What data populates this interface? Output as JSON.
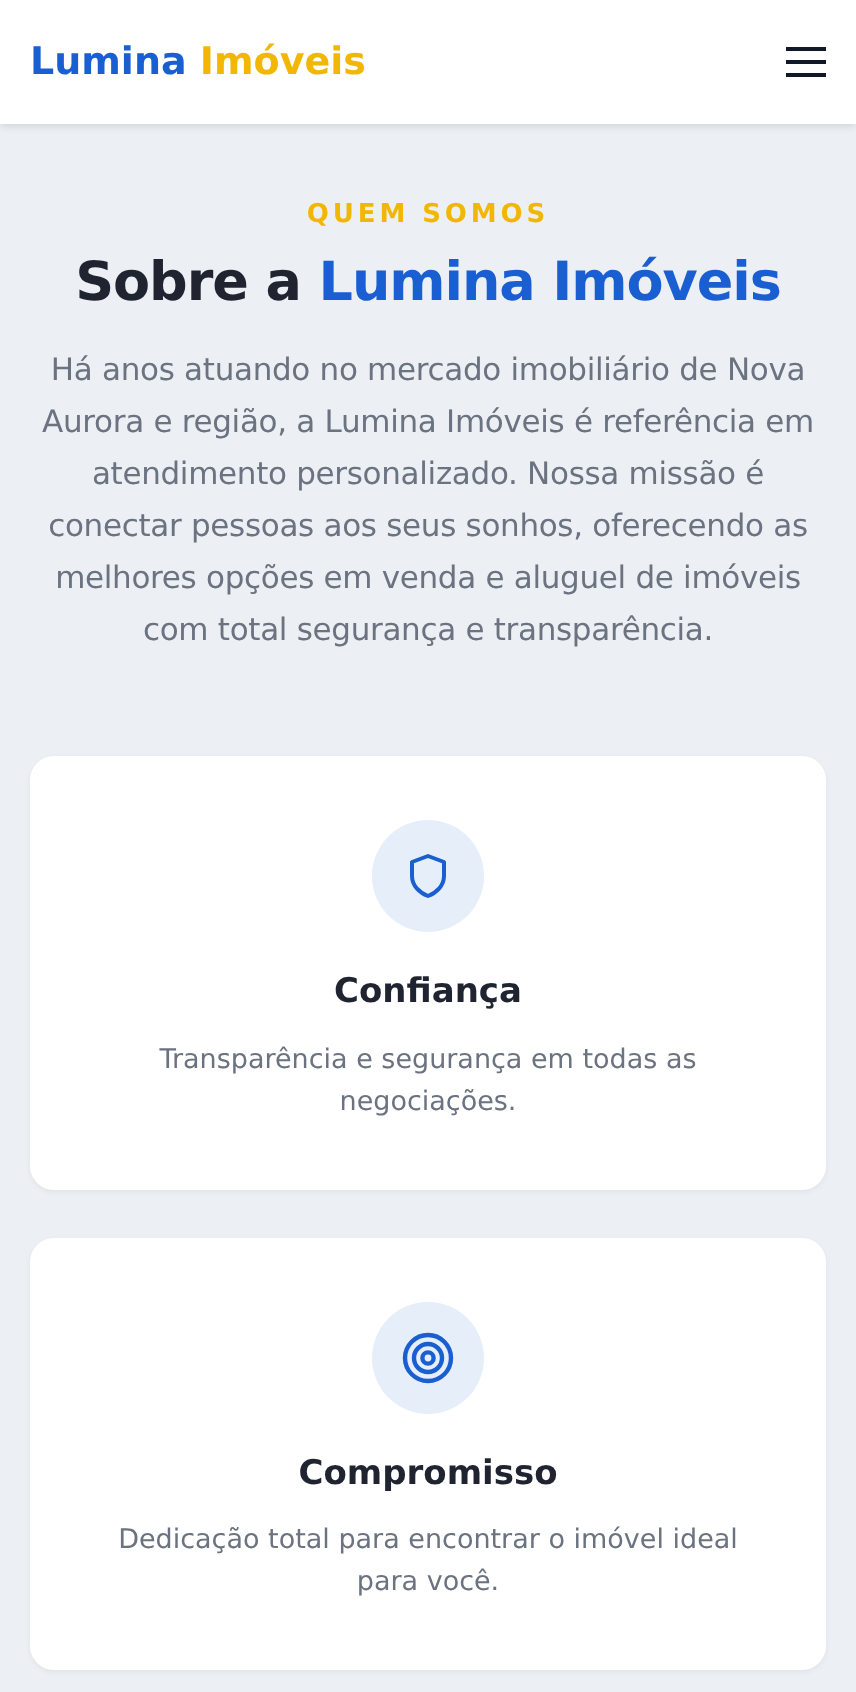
{
  "header": {
    "logo": {
      "primary": "Lumina",
      "accent": "Imóveis"
    }
  },
  "about": {
    "eyebrow": "QUEM SOMOS",
    "title_start": "Sobre a",
    "title_highlight": "Lumina Imóveis",
    "paragraph": "Há anos atuando no mercado imobiliário de Nova Aurora e região, a Lumina Imóveis é referência em atendimento personalizado. Nossa missão é conectar pessoas aos seus sonhos, oferecendo as melhores opções em venda e aluguel de imóveis com total segurança e transparência."
  },
  "values": [
    {
      "kind": "shield",
      "title": "Confiança",
      "text": "Transparência e segurança em todas as negociações."
    },
    {
      "kind": "target",
      "title": "Compromisso",
      "text": "Dedicação total para encontrar o imóvel ideal para você."
    }
  ]
}
